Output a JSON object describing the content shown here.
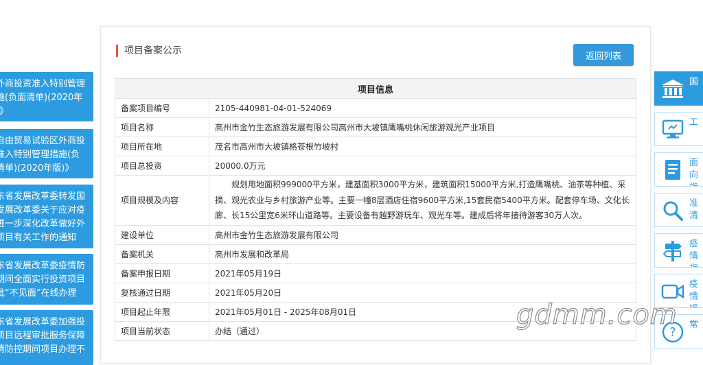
{
  "left_notices": [
    {
      "text": "外商投资准入特别管理\n施(负面清单)(2020年\n)》"
    },
    {
      "text": "自由贸易试验区外商投\n准入特别管理措施(负\n清单)(2020年版)》"
    },
    {
      "text": "东省发展改革委转发国\n发展改革委关于应对疫\n进一步深化改革做好外\n项目有关工作的通知"
    },
    {
      "text": "东省发展改革委疫情防\n期间全面实行投资项目\n批“不见面”在线办理"
    },
    {
      "text": "东省发展改革委加强投\n项目远程审批服务保障\n情防控期间项目办理不"
    }
  ],
  "card": {
    "title": "项目备案公示",
    "back_label": "返回列表",
    "table_header": "项目信息",
    "rows": [
      {
        "label": "备案项目编号",
        "value": "2105-440981-04-01-524069"
      },
      {
        "label": "项目名称",
        "value": "高州市金竹生态旅游发展有限公司高州市大坡镇鹰嘴桃休闲旅游观光产业项目"
      },
      {
        "label": "项目所在地",
        "value": "茂名市高州市大坡镇格苍根竹坡村"
      },
      {
        "label": "项目总投资",
        "value": "20000.0万元"
      },
      {
        "label": "项目规模及内容",
        "value": "规划用地面积999000平方米，建基面积3000平方米，建筑面积15000平方米,打造鹰嘴桃、油茶等种植、采摘、观光农业与乡村旅游产业等。主要一幢8层酒店住宿9600平方米,15套民宿5400平方米。配套停车场、文化长廊、长15公里宽6米环山道路等。主要设备有越野游玩车、观光车等。建成后将年接待游客30万人次。"
      },
      {
        "label": "建设单位",
        "value": "高州市金竹生态旅游发展有限公司"
      },
      {
        "label": "备案机关",
        "value": "高州市发展和改革局"
      },
      {
        "label": "备案申报日期",
        "value": "2021年05月19日"
      },
      {
        "label": "复核通过日期",
        "value": "2021年05月20日"
      },
      {
        "label": "项目起止年限",
        "value": "2021年05月01日 - 2025年08月01日"
      },
      {
        "label": "项目当前状态",
        "value": "办结（通过）"
      }
    ]
  },
  "right_bar": [
    {
      "text": "国",
      "icon": "government-building-icon",
      "active": true
    },
    {
      "text": "工",
      "icon": "computer-monitor-icon",
      "active": false
    },
    {
      "text": "面向\n指",
      "icon": "document-list-icon",
      "active": false
    },
    {
      "text": "准\n清",
      "icon": "search-magnifier-icon",
      "active": false
    },
    {
      "text": "疫情\n指",
      "icon": "signpost-icon",
      "active": false
    },
    {
      "text": "疫情\n操作",
      "icon": "video-camera-icon",
      "active": false
    },
    {
      "text": "常",
      "icon": "help-question-icon",
      "active": false
    }
  ],
  "watermark": "gdmm.com",
  "colors": {
    "accent": "#2d9be0",
    "title_bar": "#e8563b",
    "button": "#3498db"
  }
}
